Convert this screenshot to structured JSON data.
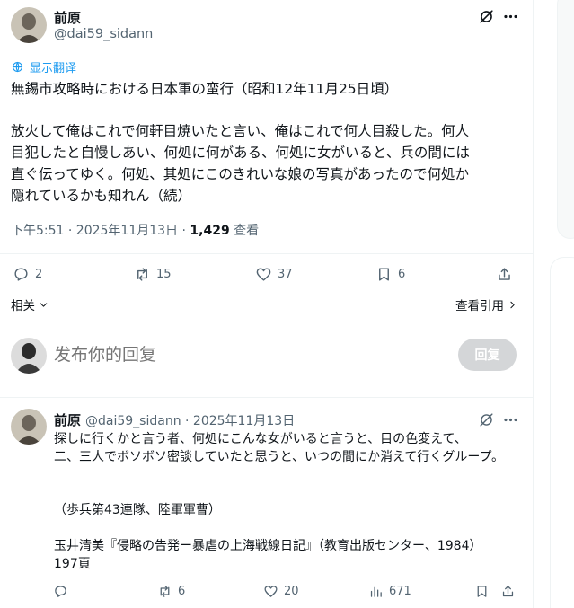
{
  "main_tweet": {
    "author_name": "前原",
    "author_handle": "@dai59_sidann",
    "translate_label": "显示翻译",
    "line_1": "無錫市攻略時における日本軍の蛮行（昭和12年11月25日頃）",
    "line_2": "放火して俺はこれで何軒目焼いたと言い、俺はこれで何人目殺した。何人",
    "line_3": "目犯したと自慢しあい、何処に何がある、何処に女がいると、兵の間には",
    "line_4": "直ぐ伝ってゆく。何処、其処にこのきれいな娘の写真があったので何処か",
    "line_5": "隠れているかも知れん（続）",
    "timestamp": "下午5:51 · 2025年11月13日 · ",
    "views_count": "1,429",
    "views_label": " 查看",
    "stats": {
      "replies": "2",
      "retweets": "15",
      "likes": "37",
      "bookmarks": "6"
    },
    "related_label": "相关",
    "view_quotes_label": "查看引用"
  },
  "reply_composer": {
    "placeholder": "发布你的回复",
    "reply_button": "回复"
  },
  "reply_tweet": {
    "author_name": "前原",
    "meta": "@dai59_sidann · 2025年11月13日",
    "line_1": "探しに行くかと言う者、何処にこんな女がいると言うと、目の色変えて、",
    "line_2": "二、三人でボソボソ密談していたと思うと、いつの間にか消えて行くグループ。",
    "line_3": "（歩兵第43連隊、陸軍軍曹）",
    "line_4": "玉井清美『侵略の告発ー暴虐の上海戦線日記』（教育出版センター、1984）",
    "line_5": "197頁",
    "stats": {
      "replies": "",
      "retweets": "6",
      "likes": "20",
      "views": "671"
    }
  },
  "colors": {
    "accent": "#1d9bf0",
    "muted": "#536471",
    "button_disabled": "#d4d6d8"
  }
}
